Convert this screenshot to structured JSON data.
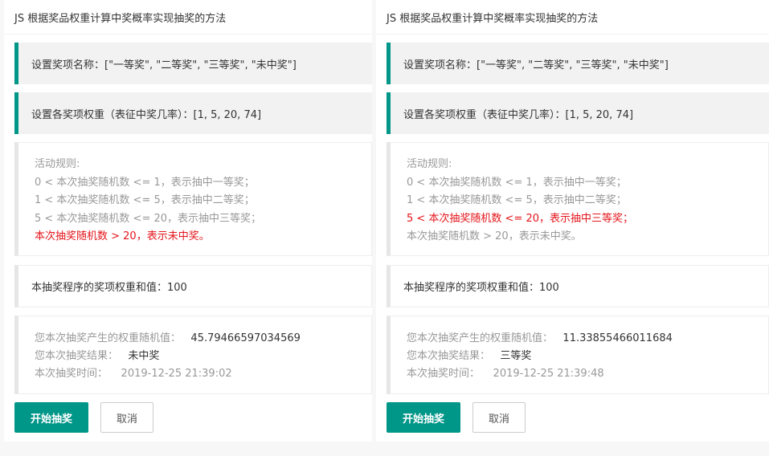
{
  "panels": [
    {
      "title": "JS 根据奖品权重计算中奖概率实现抽奖的方法",
      "prize_names": "设置奖项名称：[\"一等奖\", \"二等奖\", \"三等奖\", \"未中奖\"]",
      "weights": "设置各奖项权重（表征中奖几率）：[1, 5, 20, 74]",
      "rules_title": "活动规则:",
      "rules": [
        "0 < 本次抽奖随机数 <= 1，表示抽中一等奖；",
        "1 < 本次抽奖随机数 <= 5，表示抽中二等奖；",
        "5 < 本次抽奖随机数 <= 20，表示抽中三等奖；",
        "本次抽奖随机数 > 20，表示未中奖。"
      ],
      "highlight_rule": 3,
      "sum": "本抽奖程序的奖项权重和值：100",
      "random_label": "您本次抽奖产生的权重随机值：",
      "random_value": "45.79466597034569",
      "result_label": "您本次抽奖结果：",
      "result_value": "未中奖",
      "time_label": "本次抽奖时间：",
      "time_value": "2019-12-25 21:39:02",
      "start_label": "开始抽奖",
      "cancel_label": "取消"
    },
    {
      "title": "JS 根据奖品权重计算中奖概率实现抽奖的方法",
      "prize_names": "设置奖项名称：[\"一等奖\", \"二等奖\", \"三等奖\", \"未中奖\"]",
      "weights": "设置各奖项权重（表征中奖几率）：[1, 5, 20, 74]",
      "rules_title": "活动规则:",
      "rules": [
        "0 < 本次抽奖随机数 <= 1，表示抽中一等奖；",
        "1 < 本次抽奖随机数 <= 5，表示抽中二等奖；",
        "5 < 本次抽奖随机数 <= 20，表示抽中三等奖；",
        "本次抽奖随机数 > 20，表示未中奖。"
      ],
      "highlight_rule": 2,
      "sum": "本抽奖程序的奖项权重和值：100",
      "random_label": "您本次抽奖产生的权重随机值：",
      "random_value": "11.33855466011684",
      "result_label": "您本次抽奖结果：",
      "result_value": "三等奖",
      "time_label": "本次抽奖时间：",
      "time_value": "2019-12-25 21:39:48",
      "start_label": "开始抽奖",
      "cancel_label": "取消"
    }
  ],
  "colors": {
    "accent": "#009688",
    "highlight": "#e4141b"
  }
}
